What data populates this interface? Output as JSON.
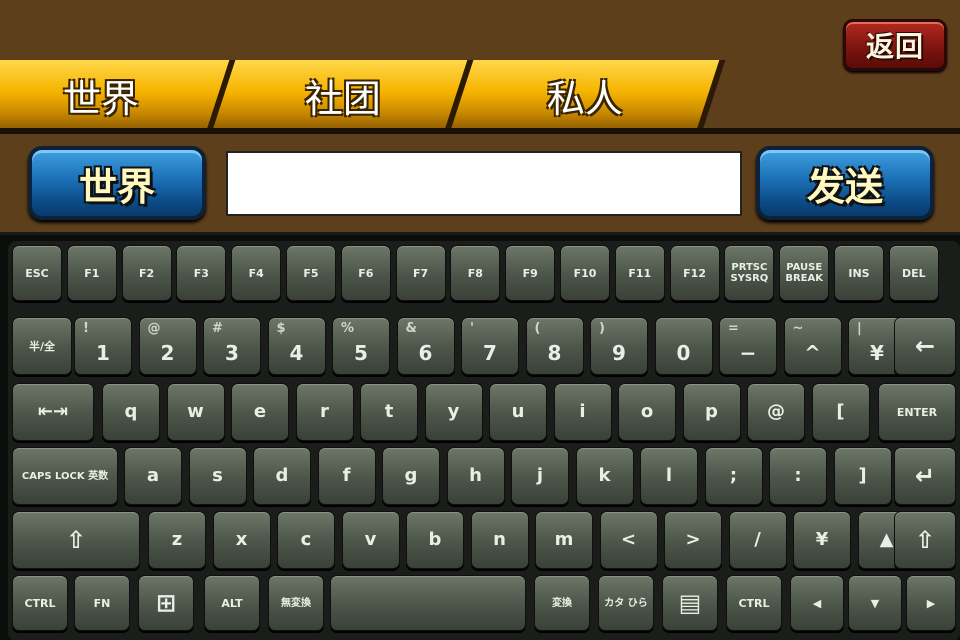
{
  "header": {
    "back_label": "返回"
  },
  "tabs": [
    {
      "label": "世界"
    },
    {
      "label": "社团"
    },
    {
      "label": "私人"
    }
  ],
  "chat_bar": {
    "channel_label": "世界",
    "input_value": "",
    "send_label": "发送"
  },
  "keyboard": {
    "row1": [
      "ESC",
      "F1",
      "F2",
      "F3",
      "F4",
      "F5",
      "F6",
      "F7",
      "F8",
      "F9",
      "F10",
      "F11",
      "F12",
      "PRTSC SYSRQ",
      "PAUSE BREAK",
      "INS",
      "DEL"
    ],
    "row2": [
      {
        "label": "半/全"
      },
      {
        "top": "!",
        "main": "1"
      },
      {
        "top": "@",
        "main": "2"
      },
      {
        "top": "#",
        "main": "3"
      },
      {
        "top": "$",
        "main": "4"
      },
      {
        "top": "%",
        "main": "5"
      },
      {
        "top": "&",
        "main": "6"
      },
      {
        "top": "'",
        "main": "7"
      },
      {
        "top": "(",
        "main": "8"
      },
      {
        "top": ")",
        "main": "9"
      },
      {
        "top": "",
        "main": "0"
      },
      {
        "top": "=",
        "main": "−"
      },
      {
        "top": "~",
        "main": "^"
      },
      {
        "top": "|",
        "main": "¥"
      },
      {
        "label": "←"
      }
    ],
    "row3": [
      "⇤⇥",
      "q",
      "w",
      "e",
      "r",
      "t",
      "y",
      "u",
      "i",
      "o",
      "p",
      "@",
      "[",
      "ENTER"
    ],
    "row4": [
      "CAPS LOCK 英数",
      "a",
      "s",
      "d",
      "f",
      "g",
      "h",
      "j",
      "k",
      "l",
      ";",
      ":",
      "]",
      "↵"
    ],
    "row5": [
      "⇧",
      "z",
      "x",
      "c",
      "v",
      "b",
      "n",
      "m",
      "<",
      ">",
      "/",
      "¥",
      "▲",
      "⇧"
    ],
    "row6": [
      "CTRL",
      "FN",
      "⊞",
      "ALT",
      "無変換",
      "",
      "変換",
      "カタ ひら",
      "▤",
      "CTRL",
      "◀",
      "▼",
      "▶"
    ]
  }
}
